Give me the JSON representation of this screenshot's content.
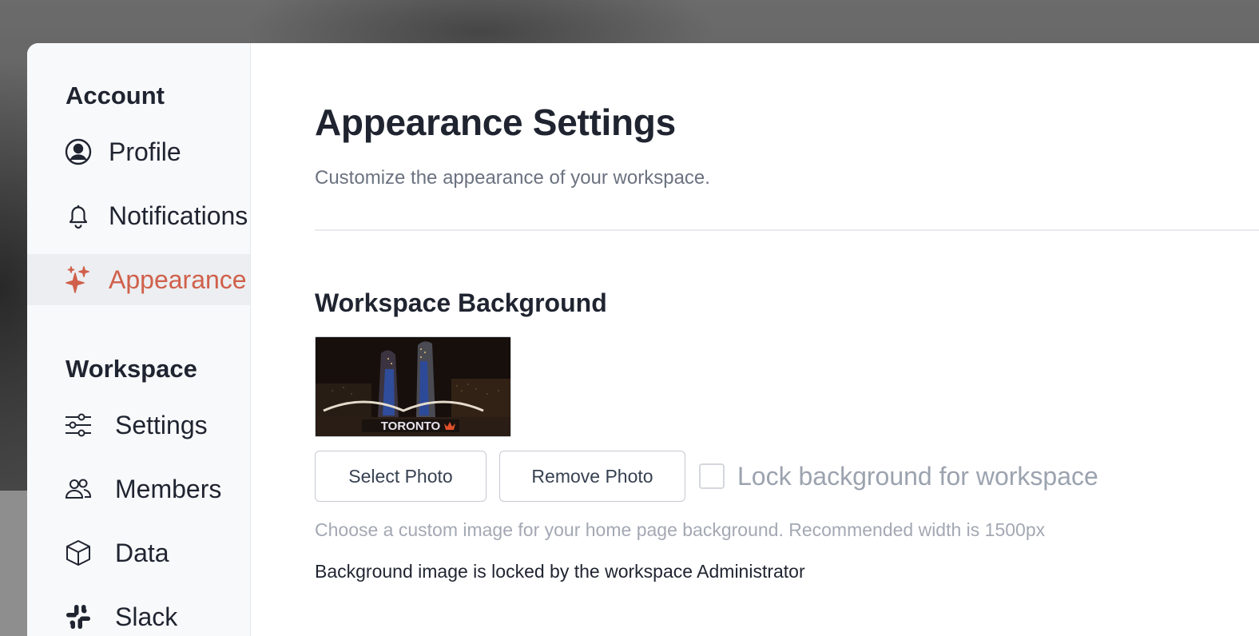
{
  "sidebar": {
    "account_title": "Account",
    "account_items": [
      {
        "label": "Profile",
        "icon": "user-circle-icon"
      },
      {
        "label": "Notifications",
        "icon": "bell-icon"
      },
      {
        "label": "Appearance",
        "icon": "sparkles-icon",
        "active": true
      }
    ],
    "workspace_title": "Workspace",
    "workspace_items": [
      {
        "label": "Settings",
        "icon": "sliders-icon"
      },
      {
        "label": "Members",
        "icon": "users-icon"
      },
      {
        "label": "Data",
        "icon": "cube-icon"
      },
      {
        "label": "Slack",
        "icon": "slack-icon"
      }
    ]
  },
  "main": {
    "title": "Appearance Settings",
    "subtitle": "Customize the appearance of your workspace.",
    "section_heading": "Workspace Background",
    "thumbnail_text": "TORONTO",
    "select_photo_label": "Select Photo",
    "remove_photo_label": "Remove Photo",
    "lock_checkbox_label": "Lock background for workspace",
    "lock_checked": false,
    "help_text": "Choose a custom image for your home page background. Recommended width is 1500px",
    "locked_notice": "Background image is locked by the workspace Administrator"
  },
  "colors": {
    "accent": "#d0604b",
    "text": "#1f2430",
    "muted": "#6b7280",
    "sidebar_bg": "#f8f9fb",
    "active_bg": "#eceef1"
  }
}
